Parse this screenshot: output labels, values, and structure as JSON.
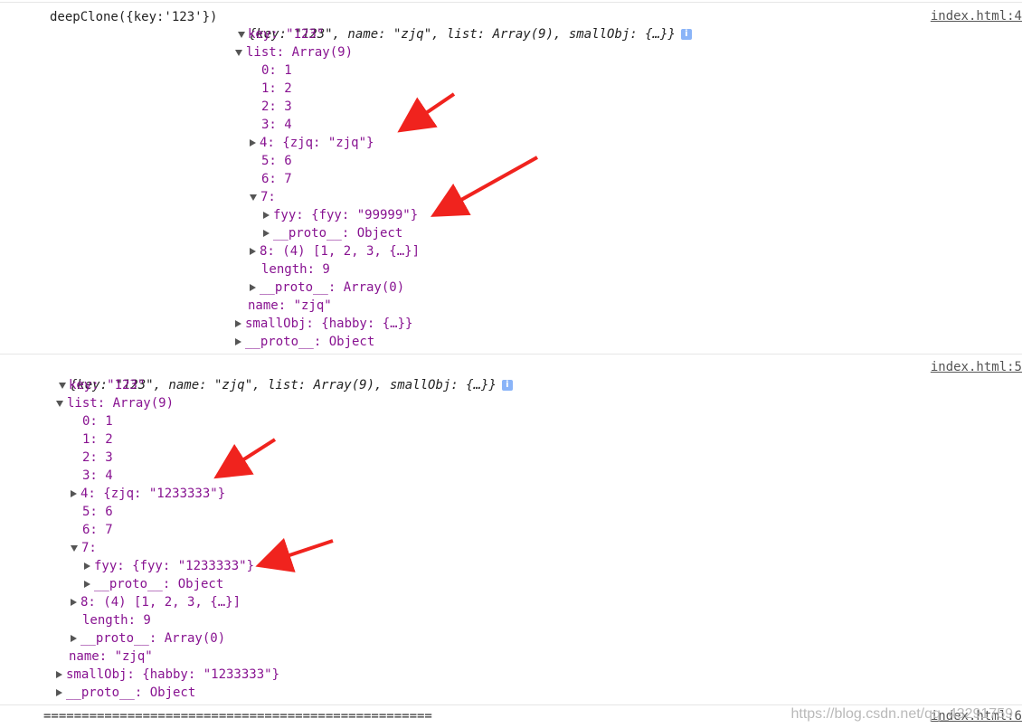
{
  "log1": {
    "prefix": "deepClone({key:'123'})",
    "summary": "{key: \"123\", name: \"zjq\", list: Array(9), smallObj: {…}}",
    "source": "index.html:4",
    "lines": [
      {
        "text": "key: \"123\""
      },
      {
        "text": "list: Array(9)"
      },
      {
        "text": "0: 1"
      },
      {
        "text": "1: 2"
      },
      {
        "text": "2: 3"
      },
      {
        "text": "3: 4"
      },
      {
        "text": "4: {zjq: \"zjq\"}"
      },
      {
        "text": "5: 6"
      },
      {
        "text": "6: 7"
      },
      {
        "text": "7:"
      },
      {
        "text": "fyy: {fyy: \"99999\"}"
      },
      {
        "text": "__proto__: Object"
      },
      {
        "text": "8: (4) [1, 2, 3, {…}]"
      },
      {
        "text": "length: 9"
      },
      {
        "text": "__proto__: Array(0)"
      },
      {
        "text": "name: \"zjq\""
      },
      {
        "text": "smallObj: {habby: {…}}"
      },
      {
        "text": "__proto__: Object"
      }
    ]
  },
  "log2": {
    "summary": "{key: \"123\", name: \"zjq\", list: Array(9), smallObj: {…}}",
    "source": "index.html:5",
    "lines": [
      {
        "text": "key: \"123\""
      },
      {
        "text": "list: Array(9)"
      },
      {
        "text": "0: 1"
      },
      {
        "text": "1: 2"
      },
      {
        "text": "2: 3"
      },
      {
        "text": "3: 4"
      },
      {
        "text": "4: {zjq: \"1233333\"}"
      },
      {
        "text": "5: 6"
      },
      {
        "text": "6: 7"
      },
      {
        "text": "7:"
      },
      {
        "text": "fyy: {fyy: \"1233333\"}"
      },
      {
        "text": "__proto__: Object"
      },
      {
        "text": "8: (4) [1, 2, 3, {…}]"
      },
      {
        "text": "length: 9"
      },
      {
        "text": "__proto__: Array(0)"
      },
      {
        "text": "name: \"zjq\""
      },
      {
        "text": "smallObj: {habby: \"1233333\"}"
      },
      {
        "text": "__proto__: Object"
      }
    ]
  },
  "separator": "===================================================",
  "source3": "index.html:6",
  "watermark": "https://blog.csdn.net/qq_43291759",
  "colors": {
    "arrow": "#f0231e",
    "key": "#881391",
    "string": "#c41a16",
    "number": "#1a1aa6"
  }
}
